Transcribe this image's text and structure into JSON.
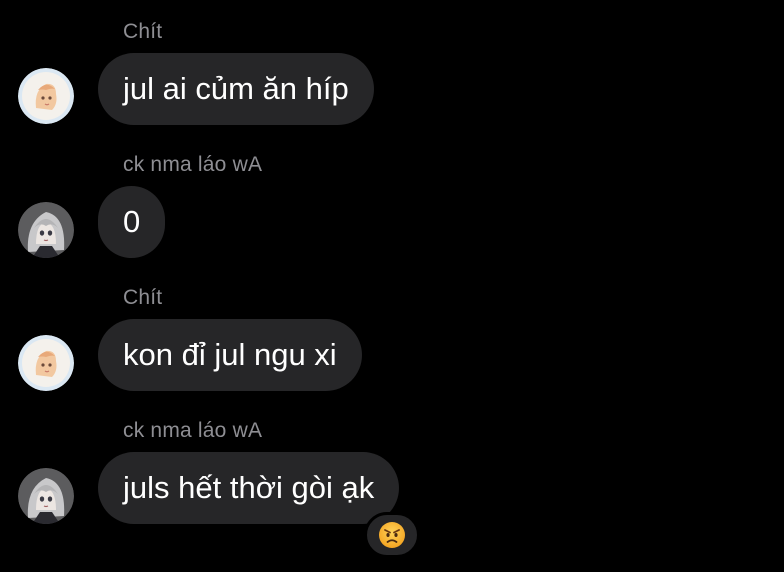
{
  "messages": [
    {
      "sender": "Chít",
      "text": "jul ai củm ăn híp",
      "avatar": "avatar-chit"
    },
    {
      "sender": "ck nma láo wA",
      "text": "0",
      "avatar": "avatar-ck"
    },
    {
      "sender": "Chít",
      "text": "kon đỉ jul ngu xi",
      "avatar": "avatar-chit"
    },
    {
      "sender": "ck nma láo wA",
      "text": "juls hết thời gòi ạk",
      "avatar": "avatar-ck"
    }
  ],
  "reaction": {
    "icon": "angry-face-emoji",
    "target_message": 3
  },
  "colors": {
    "background": "#000000",
    "bubble": "#262628",
    "sender_text": "#8e8e93",
    "message_text": "#ffffff"
  }
}
